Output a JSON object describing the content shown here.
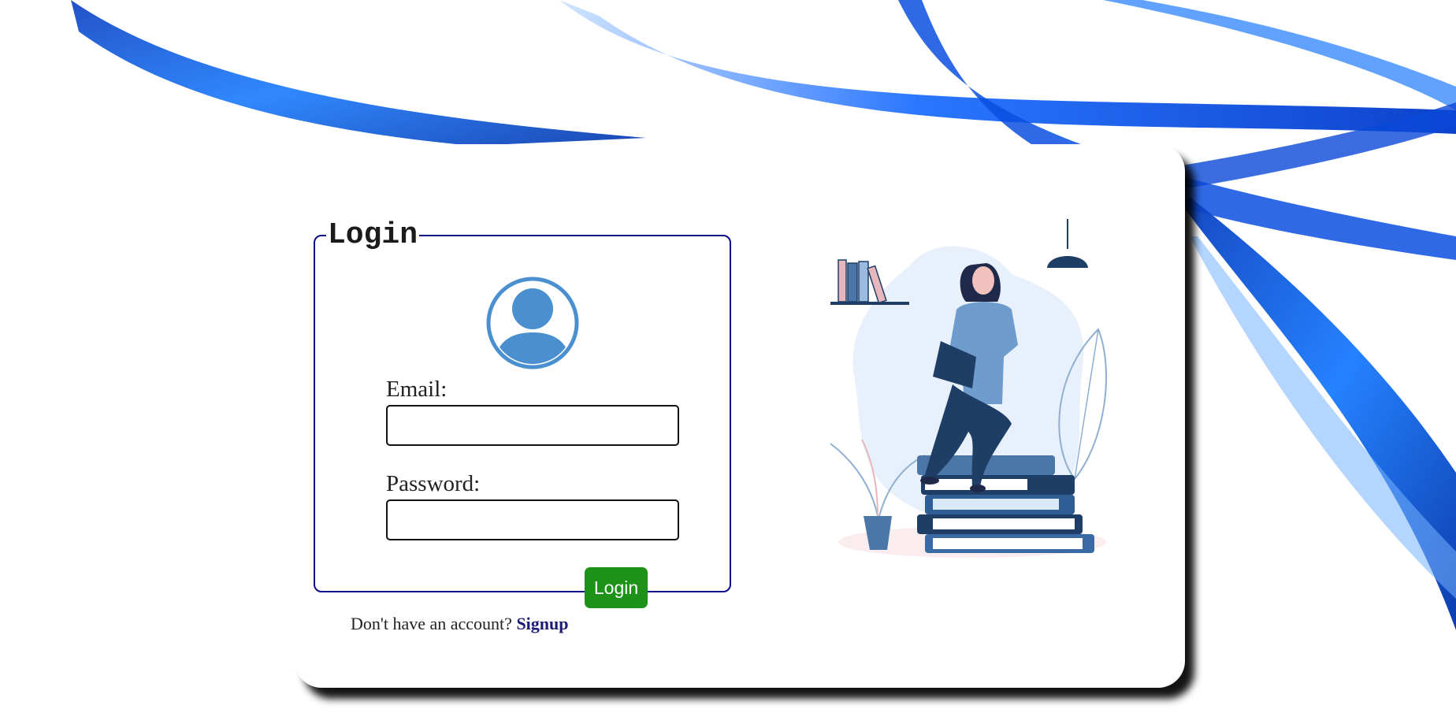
{
  "login_form": {
    "legend": "Login",
    "email_label": "Email:",
    "email_value": "",
    "password_label": "Password:",
    "password_value": "",
    "submit_label": "Login"
  },
  "signup": {
    "prompt": "Don't have an account?",
    "link_label": "Signup"
  },
  "icons": {
    "avatar": "user-avatar-icon"
  },
  "colors": {
    "legend_border": "#0d0d8a",
    "login_button": "#1e9119",
    "signup_link": "#1c1c78",
    "accent_blue": "#1565e0"
  }
}
